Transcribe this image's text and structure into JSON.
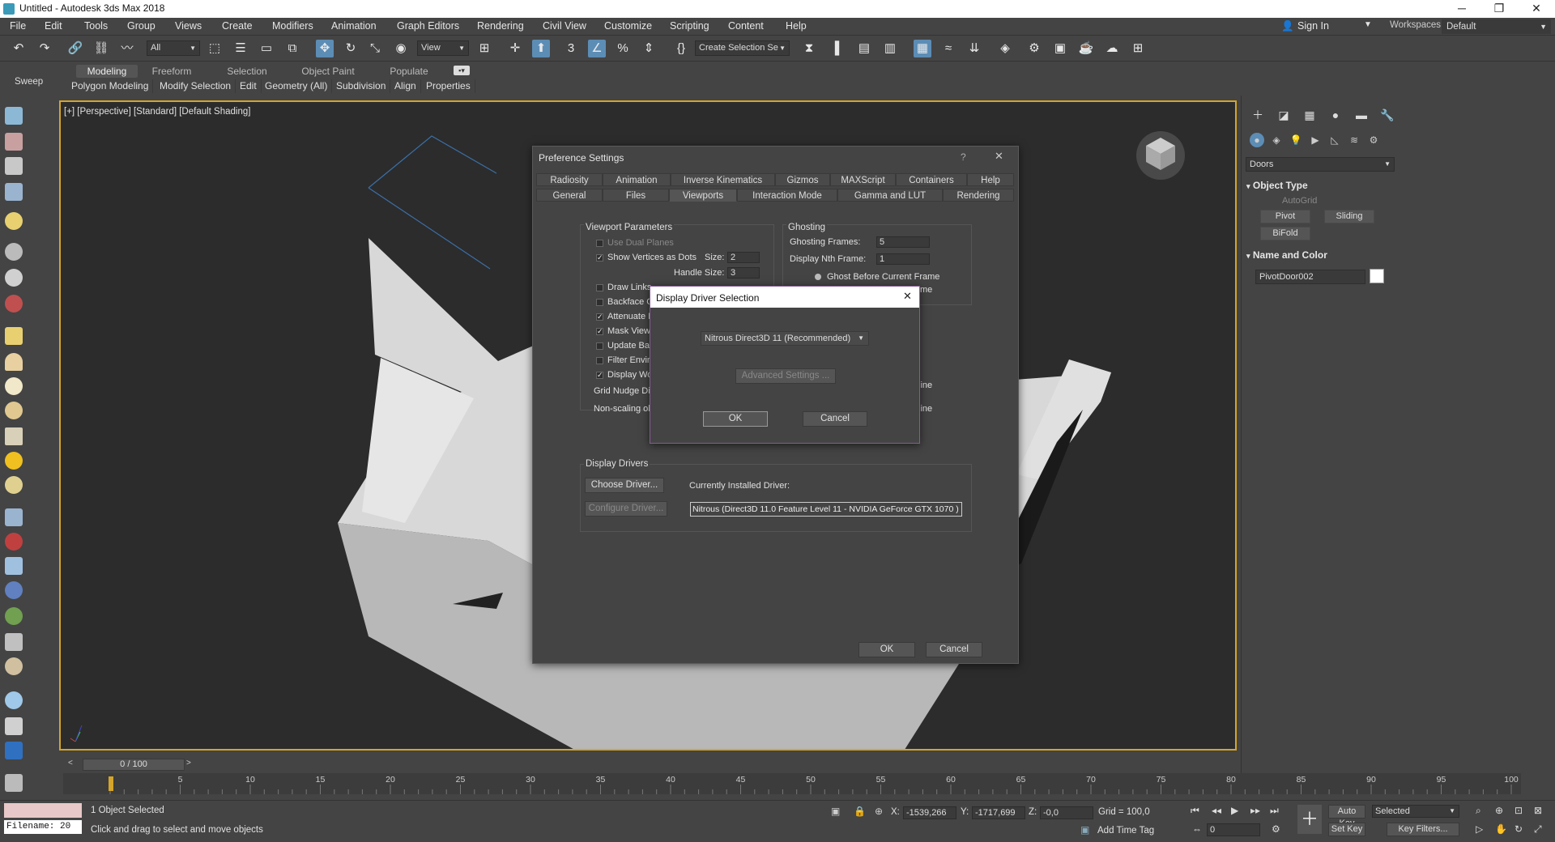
{
  "window": {
    "title": "Untitled - Autodesk 3ds Max 2018",
    "minimize": "─",
    "maximize": "❐",
    "close": "✕"
  },
  "menu": [
    "File",
    "Edit",
    "Tools",
    "Group",
    "Views",
    "Create",
    "Modifiers",
    "Animation",
    "Graph Editors",
    "Rendering",
    "Civil View",
    "Customize",
    "Scripting",
    "Content",
    "Help"
  ],
  "account": {
    "sign_in": "Sign In",
    "workspaces_label": "Workspaces:",
    "workspace_value": "Default"
  },
  "toolbar": {
    "selection_filter": "All",
    "reference_coord": "View",
    "named_selection": "Create Selection Se"
  },
  "ribbon": {
    "tabs": [
      "Modeling",
      "Freeform",
      "Selection",
      "Object Paint",
      "Populate"
    ],
    "panels": [
      "Polygon Modeling",
      "Modify Selection",
      "Edit",
      "Geometry (All)",
      "Subdivision",
      "Align",
      "Properties"
    ],
    "sweep": "Sweep"
  },
  "viewport": {
    "label": "[+] [Perspective] [Standard] [Default Shading]"
  },
  "command_panel": {
    "category": "Doors",
    "object_type_title": "Object Type",
    "autogrid": "AutoGrid",
    "buttons": [
      "Pivot",
      "Sliding",
      "BiFold"
    ],
    "name_color_title": "Name and Color",
    "object_name": "PivotDoor002"
  },
  "preferences": {
    "title": "Preference Settings",
    "help": "?",
    "close": "✕",
    "tabs_row1": [
      "Radiosity",
      "Animation",
      "Inverse Kinematics",
      "Gizmos",
      "MAXScript",
      "Containers",
      "Help"
    ],
    "tabs_row2": [
      "General",
      "Files",
      "Viewports",
      "Interaction Mode",
      "Gamma and LUT",
      "Rendering"
    ],
    "viewport_params": {
      "title": "Viewport Parameters",
      "use_dual_planes": "Use Dual Planes",
      "show_vertices": "Show Vertices as Dots",
      "size_label": "Size:",
      "size_value": "2",
      "handle_size_label": "Handle Size:",
      "handle_size_value": "3",
      "draw_links": "Draw Links",
      "backface": "Backface Cu",
      "attenuate": "Attenuate L",
      "mask_viewport": "Mask Viewp",
      "update_bac": "Update Bac",
      "filter_enviro": "Filter Enviro",
      "display_wor": "Display Wor",
      "grid_nudge": "Grid Nudge Dis",
      "non_scaling": "Non-scaling ob"
    },
    "ghosting": {
      "title": "Ghosting",
      "frames_label": "Ghosting Frames:",
      "frames_value": "5",
      "nth_label": "Display Nth Frame:",
      "nth_value": "1",
      "ghost_before": "Ghost Before Current Frame",
      "partial_me": "me",
      "partial_line1": "line",
      "partial_line2": "line"
    },
    "display_drivers": {
      "title": "Display Drivers",
      "choose": "Choose Driver...",
      "configure": "Configure Driver...",
      "installed_label": "Currently Installed Driver:",
      "installed_value": "Nitrous (Direct3D 11.0 Feature Level 11 - NVIDIA GeForce GTX 1070 )"
    },
    "ok": "OK",
    "cancel": "Cancel"
  },
  "driver_dialog": {
    "title": "Display Driver Selection",
    "close": "✕",
    "driver": "Nitrous Direct3D 11 (Recommended)",
    "advanced": "Advanced Settings ...",
    "ok": "OK",
    "cancel": "Cancel"
  },
  "timeline": {
    "frame": "0 / 100",
    "ticks": [
      "5",
      "10",
      "15",
      "20",
      "25",
      "30",
      "35",
      "40",
      "45",
      "50",
      "55",
      "60",
      "65",
      "70",
      "75",
      "80",
      "85",
      "90",
      "95",
      "100"
    ]
  },
  "status": {
    "filename": "Filename: 20",
    "selected": "1 Object Selected",
    "prompt": "Click and drag to select and move objects",
    "x_label": "X:",
    "x_value": "-1539,266",
    "y_label": "Y:",
    "y_value": "-1717,699",
    "z_label": "Z:",
    "z_value": "-0,0",
    "grid": "Grid = 100,0",
    "add_time_tag": "Add Time Tag",
    "auto_key": "Auto Key",
    "set_key": "Set Key",
    "key_mode": "Selected",
    "key_filters": "Key Filters...",
    "current_frame": "0"
  }
}
